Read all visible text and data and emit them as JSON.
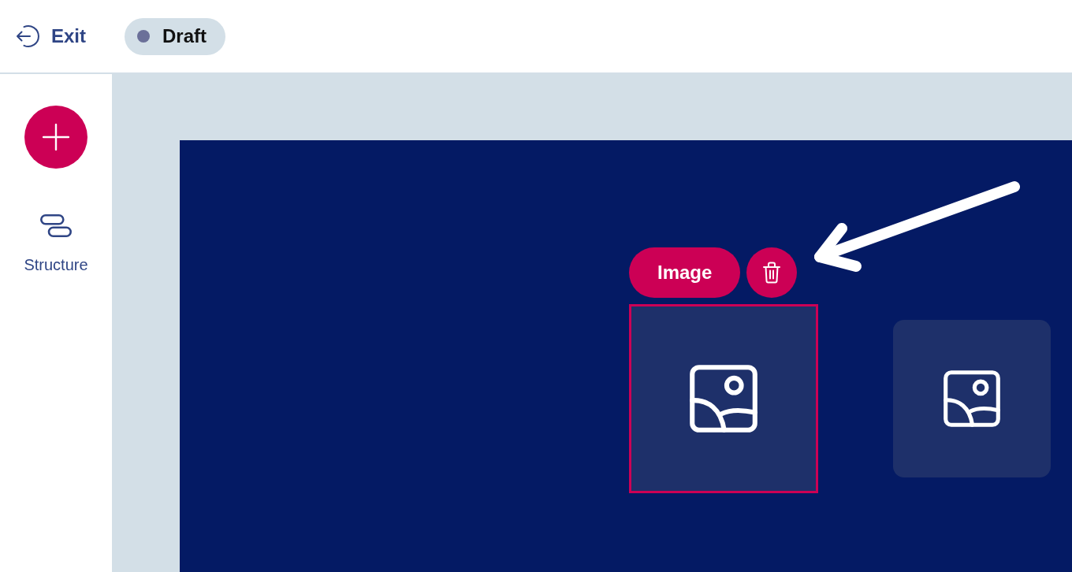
{
  "header": {
    "exit": {
      "label": "Exit"
    },
    "status": {
      "label": "Draft"
    }
  },
  "sidebar": {
    "items": [
      {
        "kind": "structure",
        "label": "Structure"
      }
    ]
  },
  "canvas": {
    "toolbar": {
      "label": "Image"
    },
    "blocks": [
      {
        "kind": "image",
        "selected": true
      },
      {
        "kind": "image",
        "selected": false
      }
    ]
  }
}
